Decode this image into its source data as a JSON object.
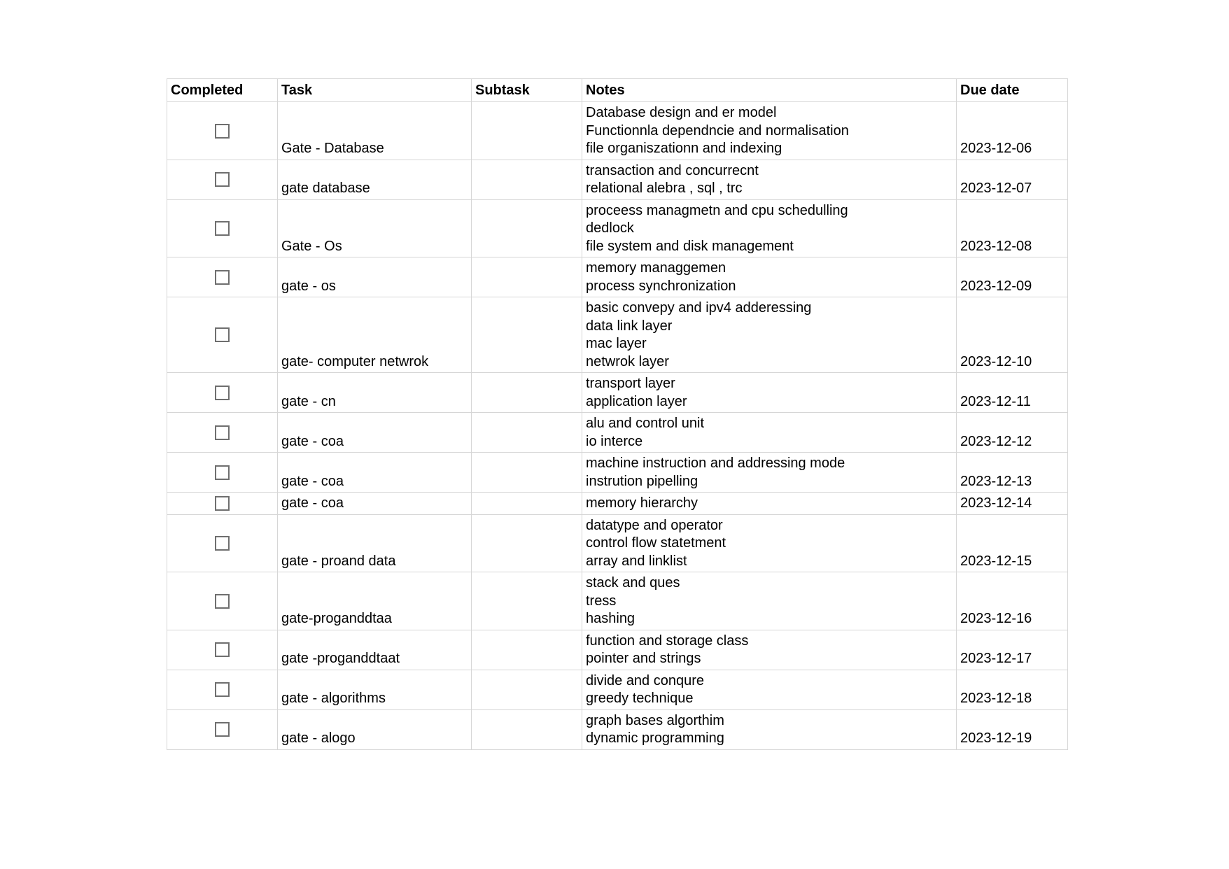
{
  "table": {
    "columns": [
      "Completed",
      "Task",
      "Subtask",
      "Notes",
      "Due date"
    ],
    "rows": [
      {
        "completed": false,
        "task": "Gate - Database",
        "subtask": "",
        "notes": [
          "Database design and er model",
          "Functionnla dependncie and normalisation",
          "file organiszationn and indexing"
        ],
        "due": "2023-12-06"
      },
      {
        "completed": false,
        "task": "gate database",
        "subtask": "",
        "notes": [
          "transaction and concurrecnt",
          "relational alebra , sql , trc"
        ],
        "due": "2023-12-07"
      },
      {
        "completed": false,
        "task": "Gate - Os",
        "subtask": "",
        "notes": [
          "proceess managmetn and cpu schedulling",
          "dedlock",
          "file system and disk management"
        ],
        "due": "2023-12-08"
      },
      {
        "completed": false,
        "task": "gate - os",
        "subtask": "",
        "notes": [
          "memory managgemen",
          "process synchronization"
        ],
        "due": "2023-12-09"
      },
      {
        "completed": false,
        "task": "gate- computer netwrok",
        "subtask": "",
        "notes": [
          "basic convepy and ipv4 adderessing",
          "data link layer",
          "mac layer",
          "netwrok layer"
        ],
        "due": "2023-12-10"
      },
      {
        "completed": false,
        "task": "gate - cn",
        "subtask": "",
        "notes": [
          "transport layer",
          "application layer"
        ],
        "due": "2023-12-11"
      },
      {
        "completed": false,
        "task": "gate - coa",
        "subtask": "",
        "notes": [
          "alu and control unit",
          "io interce"
        ],
        "due": "2023-12-12"
      },
      {
        "completed": false,
        "task": "gate - coa",
        "subtask": "",
        "notes": [
          "machine instruction and addressing mode",
          "instrution pipelling"
        ],
        "due": "2023-12-13"
      },
      {
        "completed": false,
        "task": "gate - coa",
        "subtask": "",
        "notes": [
          "memory hierarchy"
        ],
        "due": "2023-12-14"
      },
      {
        "completed": false,
        "task": "gate - proand data",
        "subtask": "",
        "notes": [
          "datatype and operator",
          "control flow statetment",
          "array and linklist"
        ],
        "due": "2023-12-15"
      },
      {
        "completed": false,
        "task": "gate-proganddtaa",
        "subtask": "",
        "notes": [
          "stack and ques",
          "tress",
          "hashing"
        ],
        "due": "2023-12-16"
      },
      {
        "completed": false,
        "task": "gate -proganddtaat",
        "subtask": "",
        "notes": [
          "function and storage class",
          "pointer and strings"
        ],
        "due": "2023-12-17"
      },
      {
        "completed": false,
        "task": "gate - algorithms",
        "subtask": "",
        "notes": [
          "divide and conqure",
          "greedy technique"
        ],
        "due": "2023-12-18"
      },
      {
        "completed": false,
        "task": "gate - alogo",
        "subtask": "",
        "notes": [
          "graph bases algorthim",
          "dynamic programming"
        ],
        "due": "2023-12-19"
      }
    ]
  },
  "colors": {
    "grid": "#d6d6d6",
    "checkbox_border": "#6f6f6f",
    "text": "#000000",
    "background": "#ffffff"
  }
}
